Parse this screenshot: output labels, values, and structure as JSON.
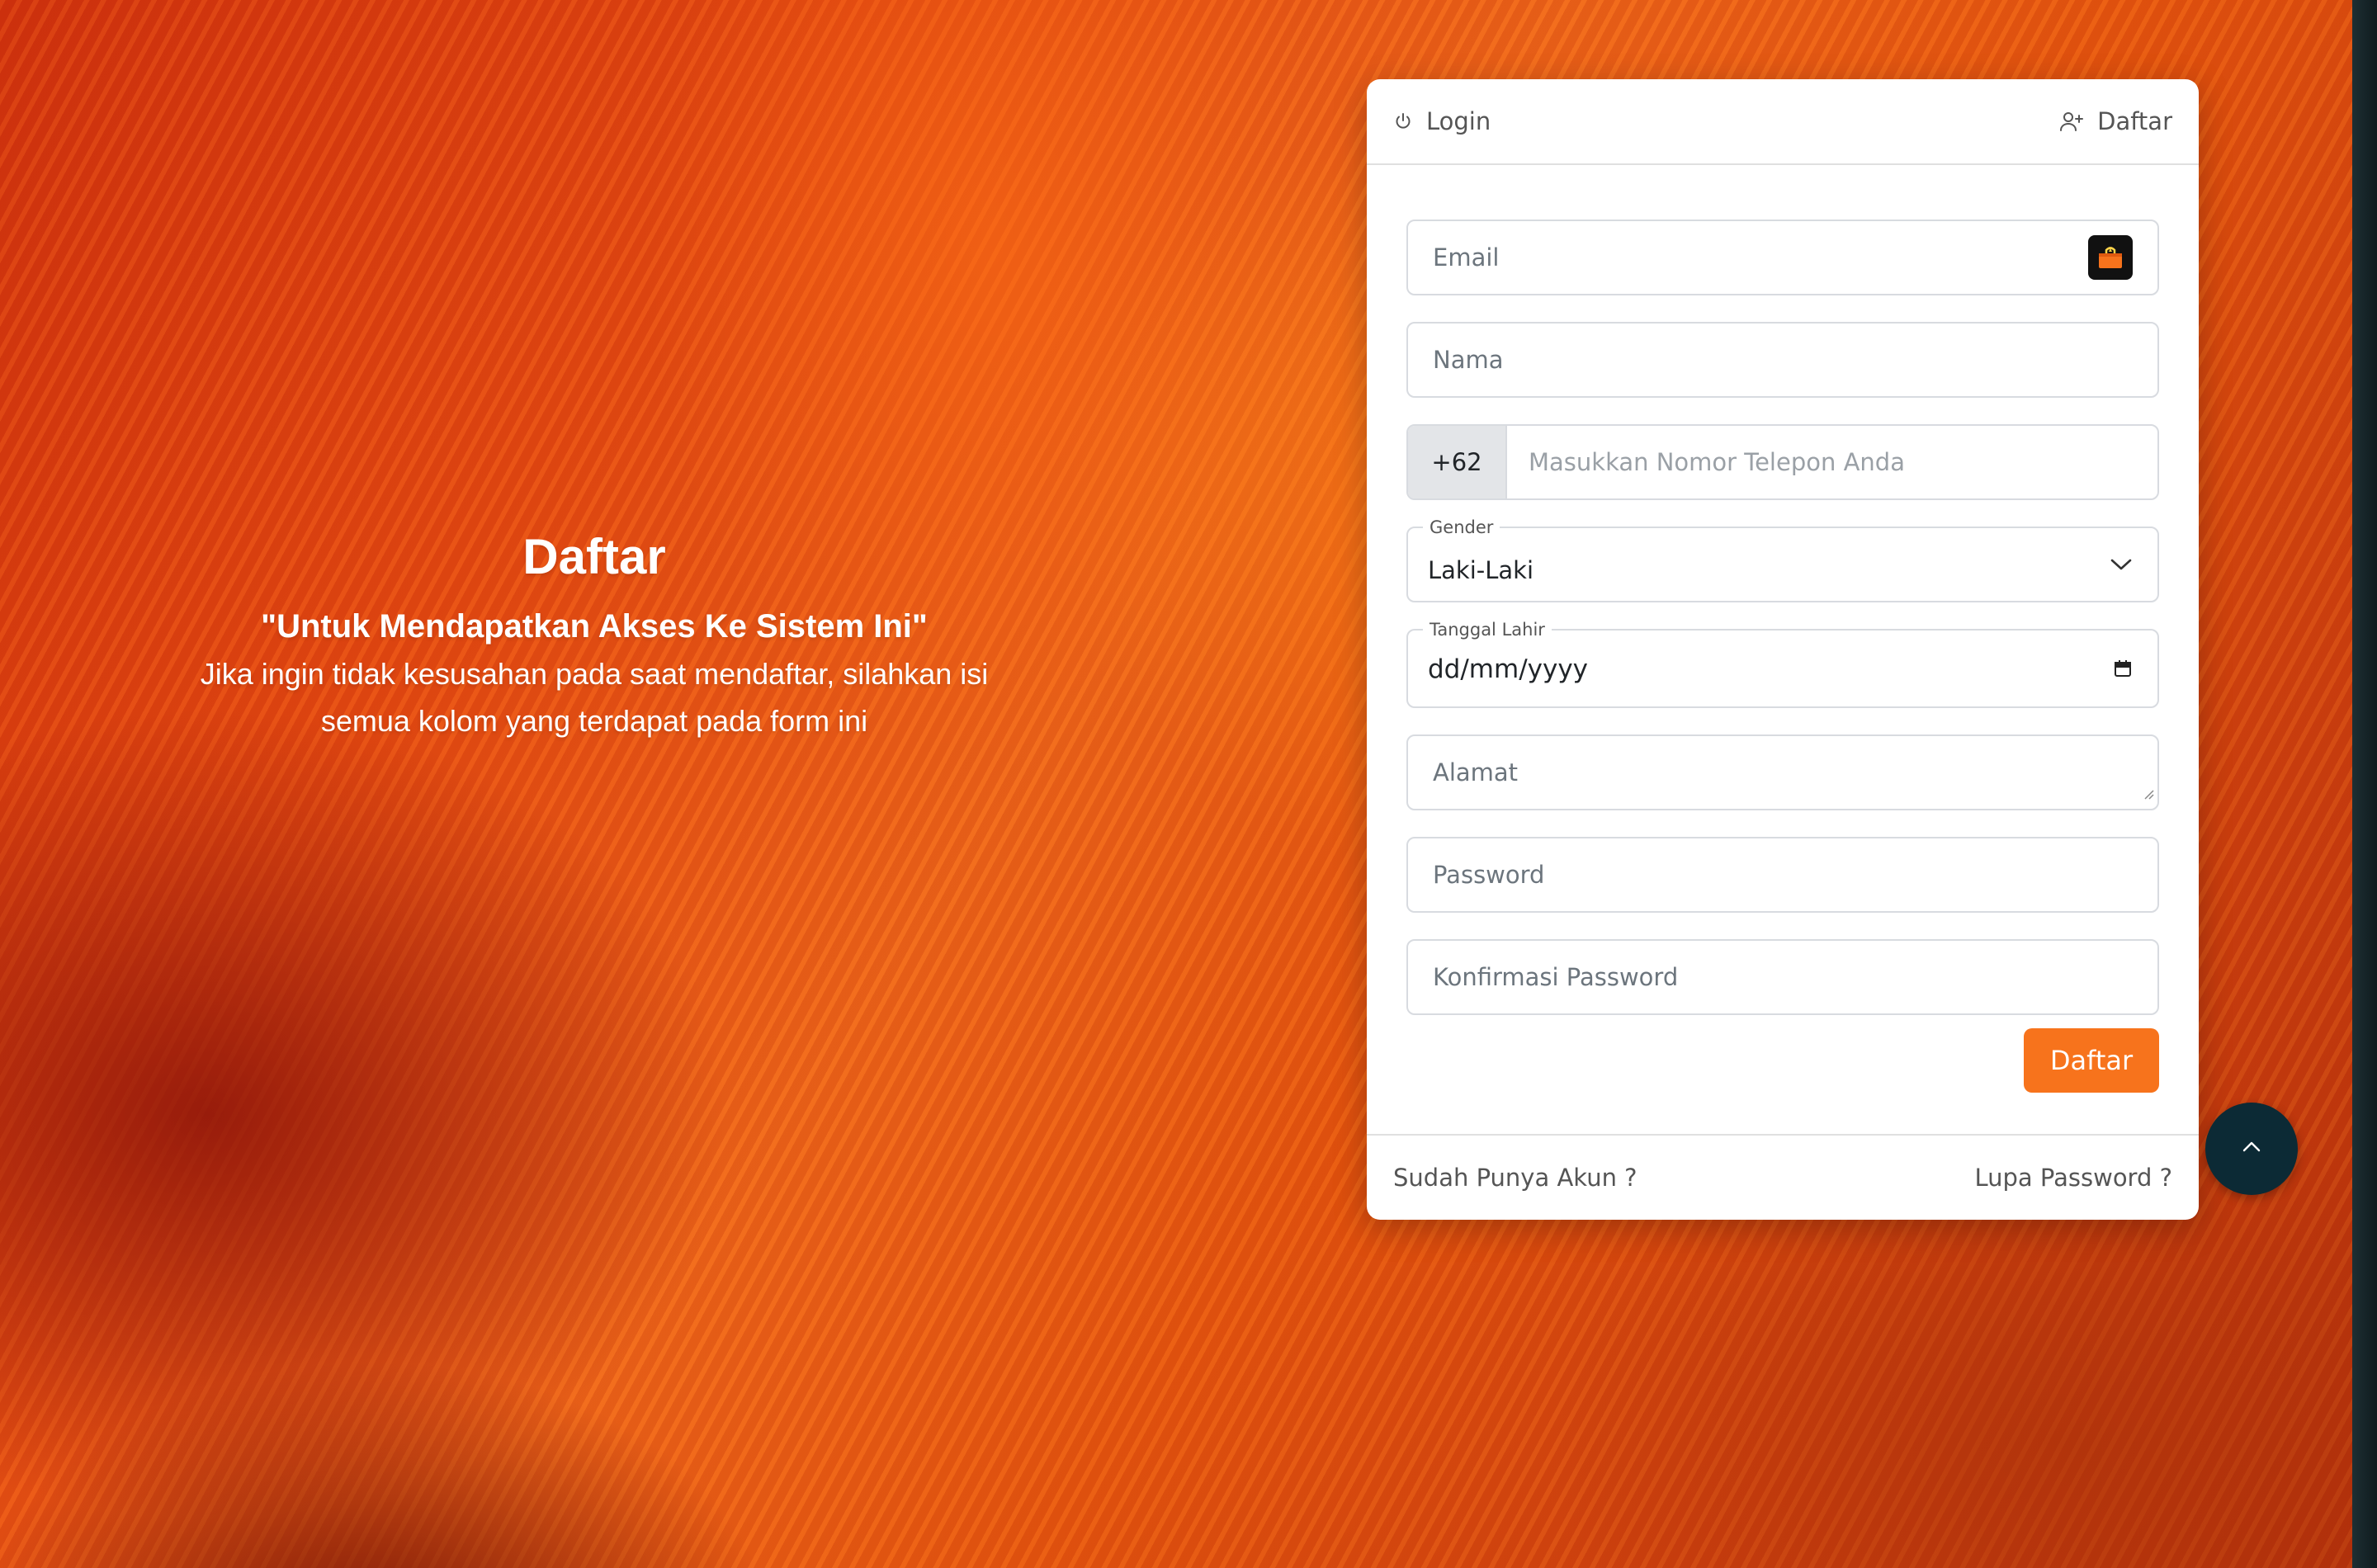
{
  "hero": {
    "title": "Daftar",
    "quote": "\"Untuk Mendapatkan Akses Ke Sistem Ini\"",
    "description": "Jika ingin tidak kesusahan pada saat mendaftar, silahkan isi semua kolom yang terdapat pada form ini"
  },
  "card": {
    "tabs": {
      "login": "Login",
      "register": "Daftar"
    },
    "form": {
      "email_placeholder": "Email",
      "name_placeholder": "Nama",
      "phone_prefix": "+62",
      "phone_placeholder": "Masukkan Nomor Telepon Anda",
      "gender_label": "Gender",
      "gender_value": "Laki-Laki",
      "birthdate_label": "Tanggal Lahir",
      "birthdate_value": "dd/mm/yyyy",
      "address_placeholder": "Alamat",
      "password_placeholder": "Password",
      "confirm_password_placeholder": "Konfirmasi Password",
      "submit_label": "Daftar"
    },
    "footer": {
      "have_account": "Sudah Punya Akun ?",
      "forgot_password": "Lupa Password ?"
    }
  },
  "icons": {
    "login_tab": "power-icon",
    "register_tab": "user-plus-icon",
    "email_badge": "password-manager-icon",
    "gender_select": "chevron-down-icon",
    "birthdate": "calendar-icon",
    "scroll_top": "chevron-up-icon"
  },
  "colors": {
    "accent": "#f7731c",
    "scroll_top_bg": "#0c2a35",
    "phone_prefix_bg": "#e3e5e8"
  }
}
